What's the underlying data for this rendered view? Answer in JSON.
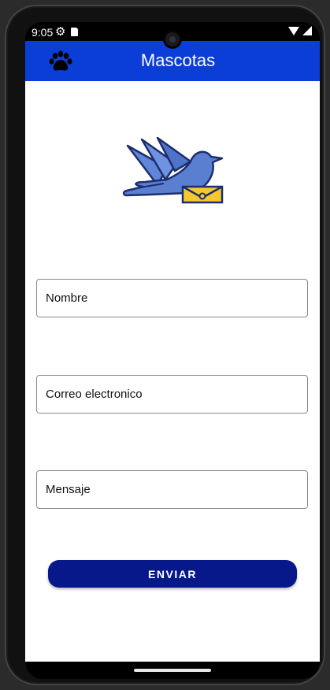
{
  "status_bar": {
    "time": "9:05",
    "icons": [
      "gear-icon",
      "sd-card-icon",
      "wifi-icon",
      "signal-icon"
    ]
  },
  "app_bar": {
    "title": "Mascotas",
    "icon": "paw-icon",
    "color": "#0a3ed6"
  },
  "logo": {
    "icon": "dove-with-envelope-icon"
  },
  "form": {
    "name_placeholder": "Nombre",
    "email_placeholder": "Correo electronico",
    "message_placeholder": "Mensaje",
    "send_label": "ENVIAR",
    "button_color": "#06188a"
  }
}
